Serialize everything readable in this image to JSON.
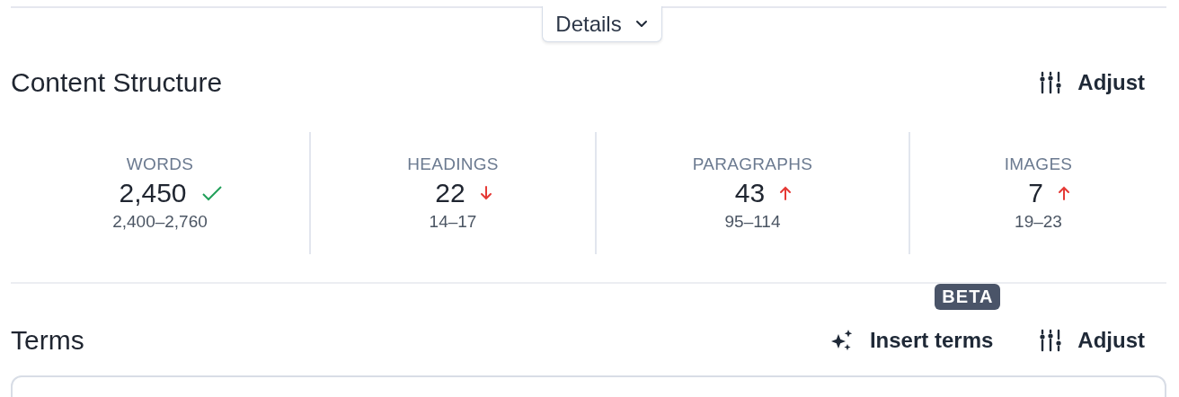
{
  "details_button": {
    "label": "Details"
  },
  "content_structure": {
    "title": "Content Structure",
    "adjust_button": "Adjust",
    "metrics": [
      {
        "label": "WORDS",
        "value": "2,450",
        "kind": "ok",
        "range": "2,400–2,760"
      },
      {
        "label": "HEADINGS",
        "value": "22",
        "kind": "down",
        "range": "14–17"
      },
      {
        "label": "PARAGRAPHS",
        "value": "43",
        "kind": "up",
        "range": "95–114"
      },
      {
        "label": "IMAGES",
        "value": "7",
        "kind": "up",
        "range": "19–23"
      }
    ]
  },
  "terms": {
    "title": "Terms",
    "insert_button": "Insert terms",
    "badge": "BETA",
    "adjust_button": "Adjust"
  }
}
